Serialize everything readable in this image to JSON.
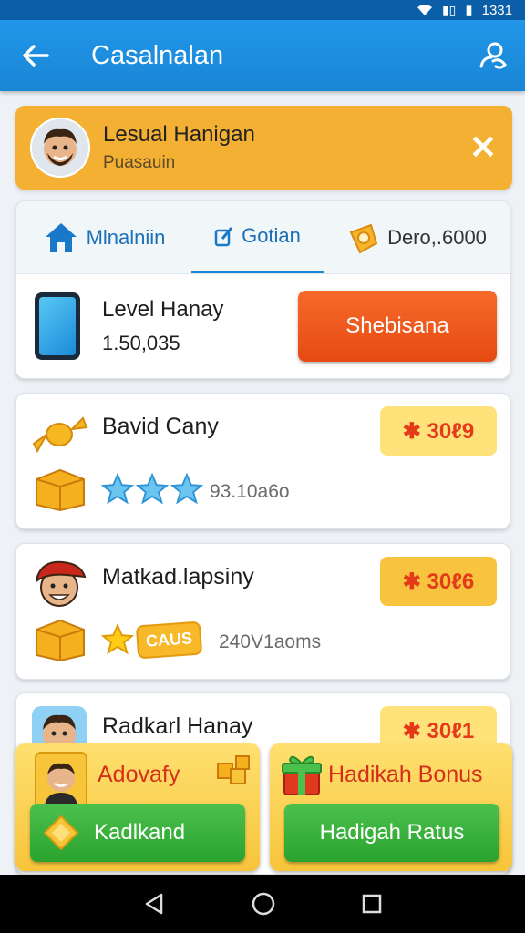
{
  "statusbar": {
    "time": "1331",
    "signal_icon": "signal-icon",
    "battery_icon": "battery-icon"
  },
  "appbar": {
    "title": "Casalnalan",
    "back_icon": "back-arrow-icon",
    "user_icon": "user-icon"
  },
  "banner": {
    "name": "Lesual Hanigan",
    "subtitle": "Puasauin",
    "close_icon": "close-icon"
  },
  "tabs": [
    {
      "label": "Mlnalniin",
      "icon": "home-icon"
    },
    {
      "label": "Gotian",
      "icon": "edit-icon"
    },
    {
      "label": "Dero,.6000",
      "icon": "coin-icon"
    }
  ],
  "level": {
    "title": "Level Hanay",
    "value": "1.50,035",
    "button": "Shebisana"
  },
  "entries": [
    {
      "name": "Bavid Cany",
      "badge": "✱ 30ℓ9",
      "meta": "93.10a6o",
      "stars": 3
    },
    {
      "name": "Matkad.lapsiny",
      "badge": "✱ 30ℓ6",
      "meta": "240V1aoms",
      "pill": "CAUS"
    },
    {
      "name": "Radkarl Hanay",
      "badge": "✱ 30ℓ1"
    }
  ],
  "bonuses": [
    {
      "title": "Adovafy",
      "button": "Kadlkand"
    },
    {
      "title": "Hadikah Bonus",
      "button": "Hadigah Ratus"
    }
  ],
  "colors": {
    "appbar": "#1a86d6",
    "banner": "#f4b032",
    "orange_button": "#e64a12",
    "green_button": "#2ba32f",
    "badge": "#ffe27a"
  }
}
